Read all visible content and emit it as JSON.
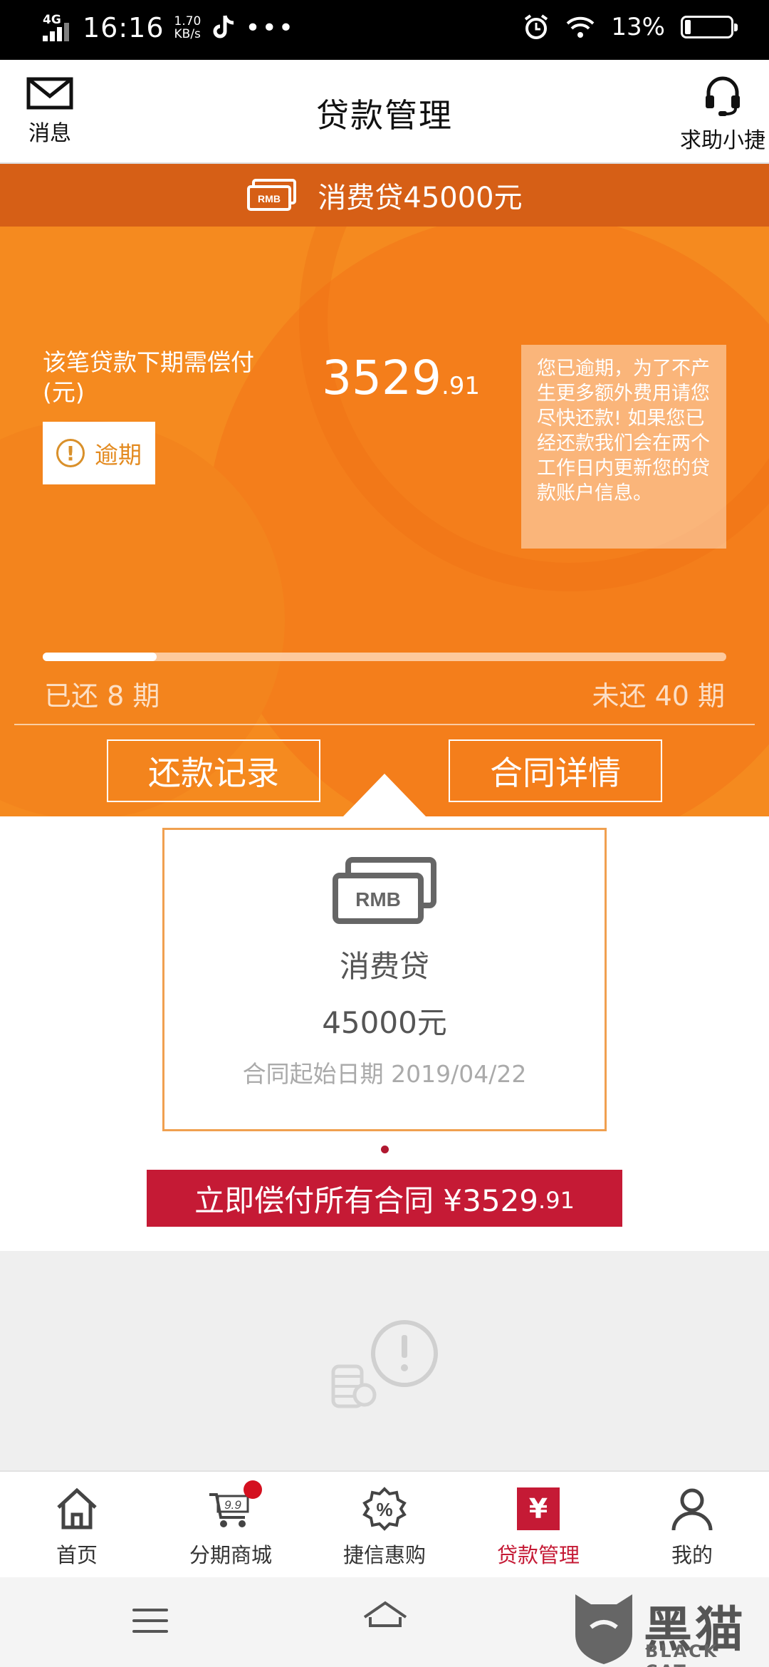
{
  "status_bar": {
    "network": "4G",
    "time": "16:16",
    "speed_value": "1.70",
    "speed_unit": "KB/s",
    "dots": "•••",
    "battery": "13%",
    "battery_level": 0.13
  },
  "header": {
    "messages_label": "消息",
    "title": "贷款管理",
    "help_label": "求助小捷"
  },
  "loan_banner": {
    "text": "消费贷45000元"
  },
  "summary": {
    "due_label": "该笔贷款下期需偿付(元)",
    "amount_int": "3529",
    "amount_dec": ".91",
    "status_tag": "逾期",
    "notice": "您已逾期，为了不产生更多额外费用请您尽快还款! 如果您已经还款我们会在两个工作日内更新您的贷款账户信息。",
    "progress_fraction": 0.1667,
    "paid_text": "已还 8 期",
    "unpaid_text": "未还 40 期"
  },
  "buttons": {
    "repayment_records": "还款记录",
    "contract_details": "合同详情"
  },
  "contract_card": {
    "rmb_label": "RMB",
    "name": "消费贷",
    "amount": "45000元",
    "start_date": "合同起始日期 2019/04/22"
  },
  "pay_all": {
    "label": "立即偿付所有合同 ¥3529",
    "decimal": ".91"
  },
  "tabs": [
    {
      "label": "首页",
      "icon": "home-icon"
    },
    {
      "label": "分期商城",
      "icon": "cart-icon",
      "cart_text": "9.9"
    },
    {
      "label": "捷信惠购",
      "icon": "discount-icon",
      "symbol": "%"
    },
    {
      "label": "贷款管理",
      "icon": "yen-icon",
      "symbol": "¥",
      "active": true
    },
    {
      "label": "我的",
      "icon": "user-icon"
    }
  ],
  "watermark": {
    "text": "黑猫",
    "sub": "BLACK CAT"
  },
  "colors": {
    "orange": "#f58a1f",
    "banner": "#d65f16",
    "accent_red": "#c51a35",
    "card_border": "#f0a050"
  }
}
